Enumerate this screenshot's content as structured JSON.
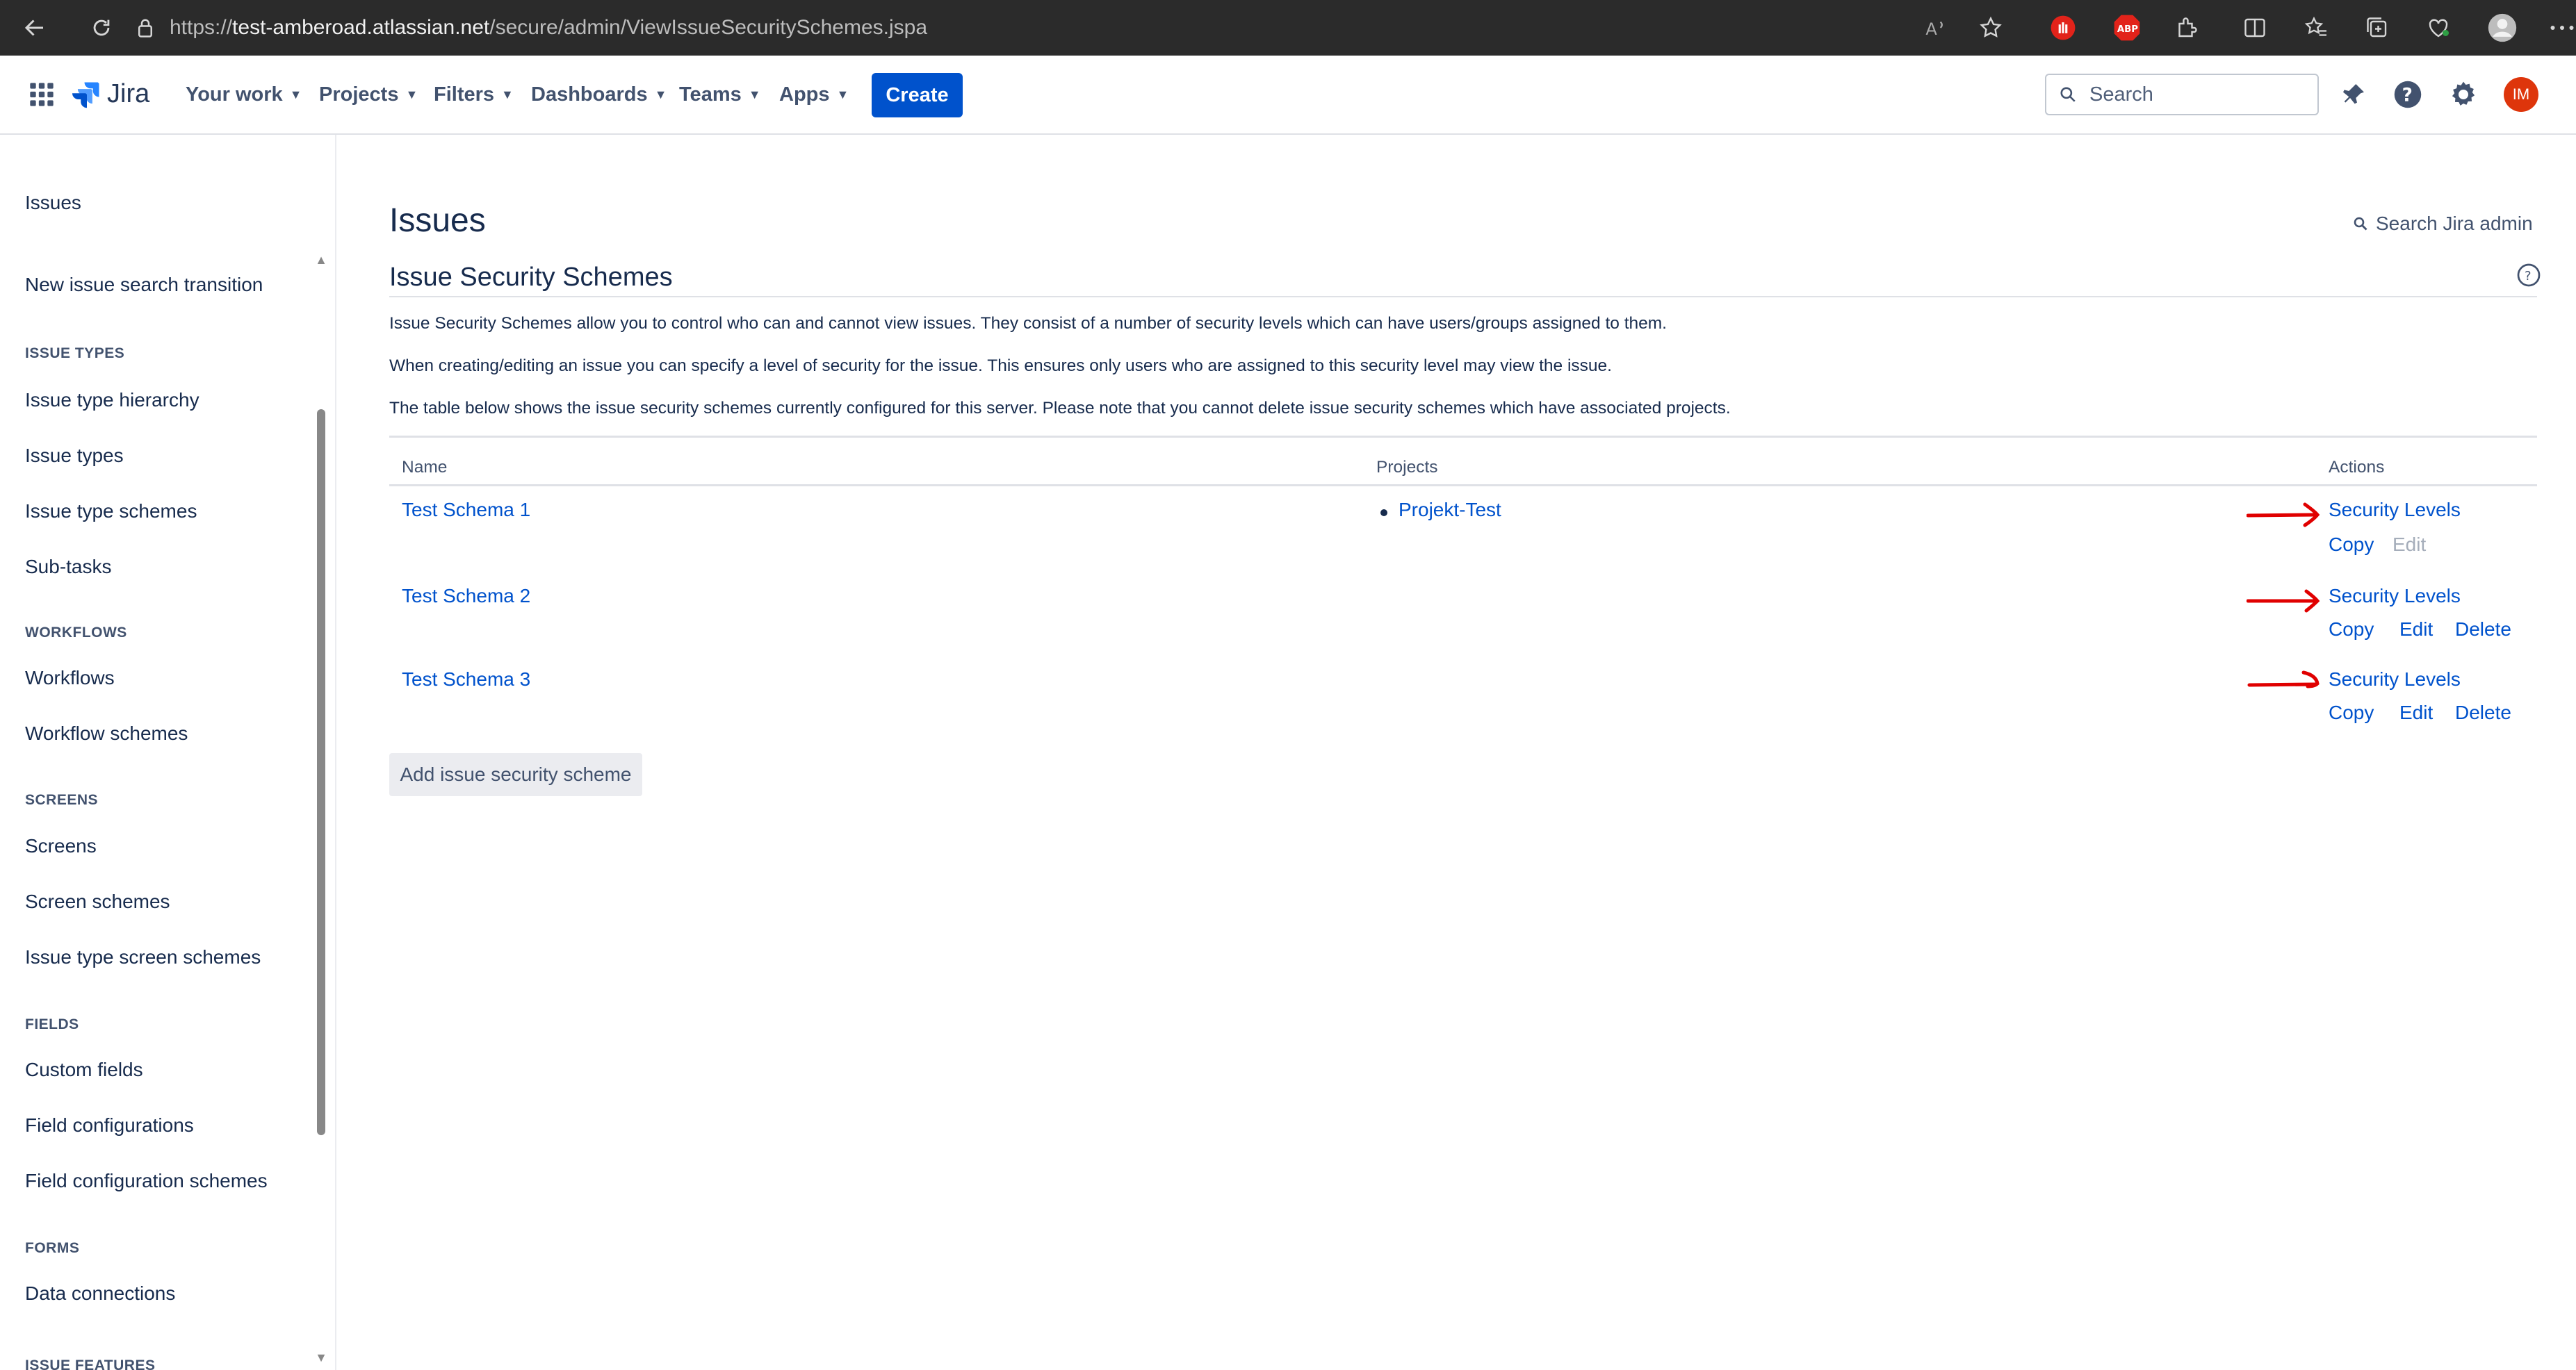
{
  "browser": {
    "url_prefix": "https://",
    "url_host": "test-amberoad.atlassian.net",
    "url_path": "/secure/admin/ViewIssueSecuritySchemes.jspa"
  },
  "topnav": {
    "product": "Jira",
    "items": [
      "Your work",
      "Projects",
      "Filters",
      "Dashboards",
      "Teams",
      "Apps"
    ],
    "create_label": "Create",
    "search_placeholder": "Search",
    "avatar_initials": "IM"
  },
  "sidebar": {
    "title": "Issues",
    "top_item": "New issue search transition",
    "sections": [
      {
        "label": "ISSUE TYPES",
        "items": [
          "Issue type hierarchy",
          "Issue types",
          "Issue type schemes",
          "Sub-tasks"
        ]
      },
      {
        "label": "WORKFLOWS",
        "items": [
          "Workflows",
          "Workflow schemes"
        ]
      },
      {
        "label": "SCREENS",
        "items": [
          "Screens",
          "Screen schemes",
          "Issue type screen schemes"
        ]
      },
      {
        "label": "FIELDS",
        "items": [
          "Custom fields",
          "Field configurations",
          "Field configuration schemes"
        ]
      },
      {
        "label": "FORMS",
        "items": [
          "Data connections"
        ]
      },
      {
        "label": "ISSUE FEATURES",
        "items": []
      }
    ]
  },
  "main": {
    "page_title": "Issues",
    "admin_search": "Search Jira admin",
    "section_title": "Issue Security Schemes",
    "paragraphs": [
      "Issue Security Schemes allow you to control who can and cannot view issues. They consist of a number of security levels which can have users/groups assigned to them.",
      "When creating/editing an issue you can specify a level of security for the issue. This ensures only users who are assigned to this security level may view the issue.",
      "The table below shows the issue security schemes currently configured for this server. Please note that you cannot delete issue security schemes which have associated projects."
    ],
    "table": {
      "headers": {
        "name": "Name",
        "projects": "Projects",
        "actions": "Actions"
      },
      "rows": [
        {
          "name": "Test Schema 1",
          "project": "Projekt-Test",
          "security_levels": "Security Levels",
          "copy": "Copy",
          "edit": "Edit",
          "delete": "",
          "edit_disabled": true
        },
        {
          "name": "Test Schema 2",
          "project": "",
          "security_levels": "Security Levels",
          "copy": "Copy",
          "edit": "Edit",
          "delete": "Delete",
          "edit_disabled": false
        },
        {
          "name": "Test Schema 3",
          "project": "",
          "security_levels": "Security Levels",
          "copy": "Copy",
          "edit": "Edit",
          "delete": "Delete",
          "edit_disabled": false
        }
      ]
    },
    "add_button": "Add issue security scheme"
  },
  "colors": {
    "link": "#0052cc",
    "create_button": "#0052cc",
    "annotation_arrow": "#e00000",
    "avatar": "#de350b"
  }
}
